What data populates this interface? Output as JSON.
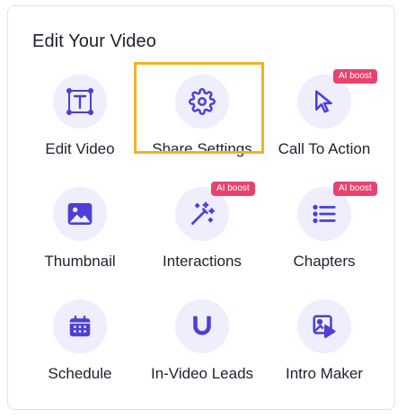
{
  "panel": {
    "title": "Edit Your Video"
  },
  "colors": {
    "accent": "#4b3fd6",
    "icon_bg": "#eeeefc",
    "badge": "#e8436f",
    "highlight": "#f0b323"
  },
  "tiles": [
    {
      "label": "Edit Video",
      "icon": "text-frame-icon",
      "badge": ""
    },
    {
      "label": "Share Settings",
      "icon": "gear-icon",
      "badge": "",
      "highlighted": true
    },
    {
      "label": "Call To Action",
      "icon": "cursor-icon",
      "badge": "AI boost"
    },
    {
      "label": "Thumbnail",
      "icon": "image-icon",
      "badge": ""
    },
    {
      "label": "Interactions",
      "icon": "magic-wand-icon",
      "badge": "AI boost"
    },
    {
      "label": "Chapters",
      "icon": "list-icon",
      "badge": "AI boost"
    },
    {
      "label": "Schedule",
      "icon": "calendar-icon",
      "badge": ""
    },
    {
      "label": "In-Video Leads",
      "icon": "magnet-icon",
      "badge": ""
    },
    {
      "label": "Intro Maker",
      "icon": "image-play-icon",
      "badge": ""
    }
  ]
}
